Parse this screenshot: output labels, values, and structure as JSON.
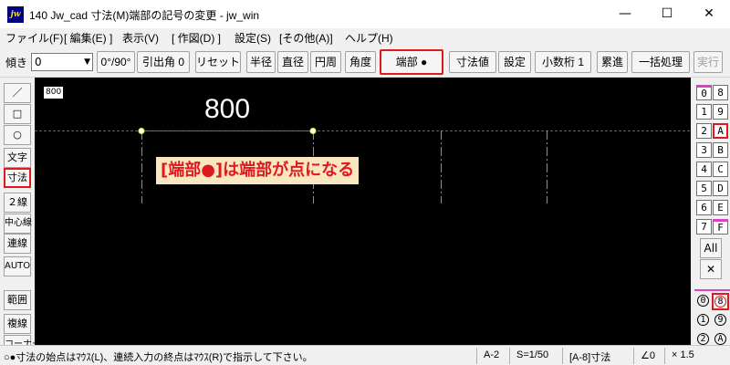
{
  "window": {
    "title": "140 Jw_cad 寸法(M)端部の記号の変更 - jw_win",
    "icon_label": "jw",
    "minimize": "—",
    "maximize": "☐",
    "close": "✕"
  },
  "menu": [
    "ファイル(F)",
    "[ 編集(E) ]",
    "表示(V)",
    "[ 作図(D) ]",
    "設定(S)",
    "[その他(A)]",
    "ヘルプ(H)"
  ],
  "toolbar": {
    "tilt_label": "傾き",
    "tilt_value": "0",
    "buttons": [
      "0°/90°",
      "引出角 0",
      "リセット",
      "半径",
      "直径",
      "円周",
      "角度",
      "端部 ●",
      "寸法値",
      "設定",
      "小数桁 1",
      "累進",
      "一括処理",
      "実行"
    ]
  },
  "left_tools": [
    "／",
    "□",
    "○",
    "文字",
    "寸法",
    "２線",
    "中心線",
    "連線",
    "AUTO",
    "範囲",
    "複線",
    "コーナー"
  ],
  "canvas": {
    "scale_label": "800",
    "dimension_value": "800",
    "annotation": "[端部●]は端部が点になる"
  },
  "layers": {
    "left_col": [
      "0",
      "1",
      "2",
      "3",
      "4",
      "5",
      "6",
      "7"
    ],
    "right_col": [
      "8",
      "9",
      "A",
      "B",
      "C",
      "D",
      "E",
      "F"
    ],
    "all_label": "All",
    "clear_label": "✕",
    "groups": [
      "0",
      "8",
      "1",
      "9",
      "2",
      "A"
    ]
  },
  "status": {
    "message": "○●寸法の始点はﾏｳｽ(L)、連続入力の終点はﾏｳｽ(R)で指示して下さい。",
    "paper": "A-2",
    "scale": "S=1/50",
    "layer": "[A-8]寸法",
    "angle": "∠0",
    "factor": "× 1.5"
  },
  "colors": {
    "canvas_bg": "#000000",
    "highlight": "#e0191f",
    "annotation_bg": "#f8e7c0",
    "dim_line": "#3a5aff",
    "extension_line": "#00cccc",
    "dim_segment": "#3a9a3a"
  }
}
